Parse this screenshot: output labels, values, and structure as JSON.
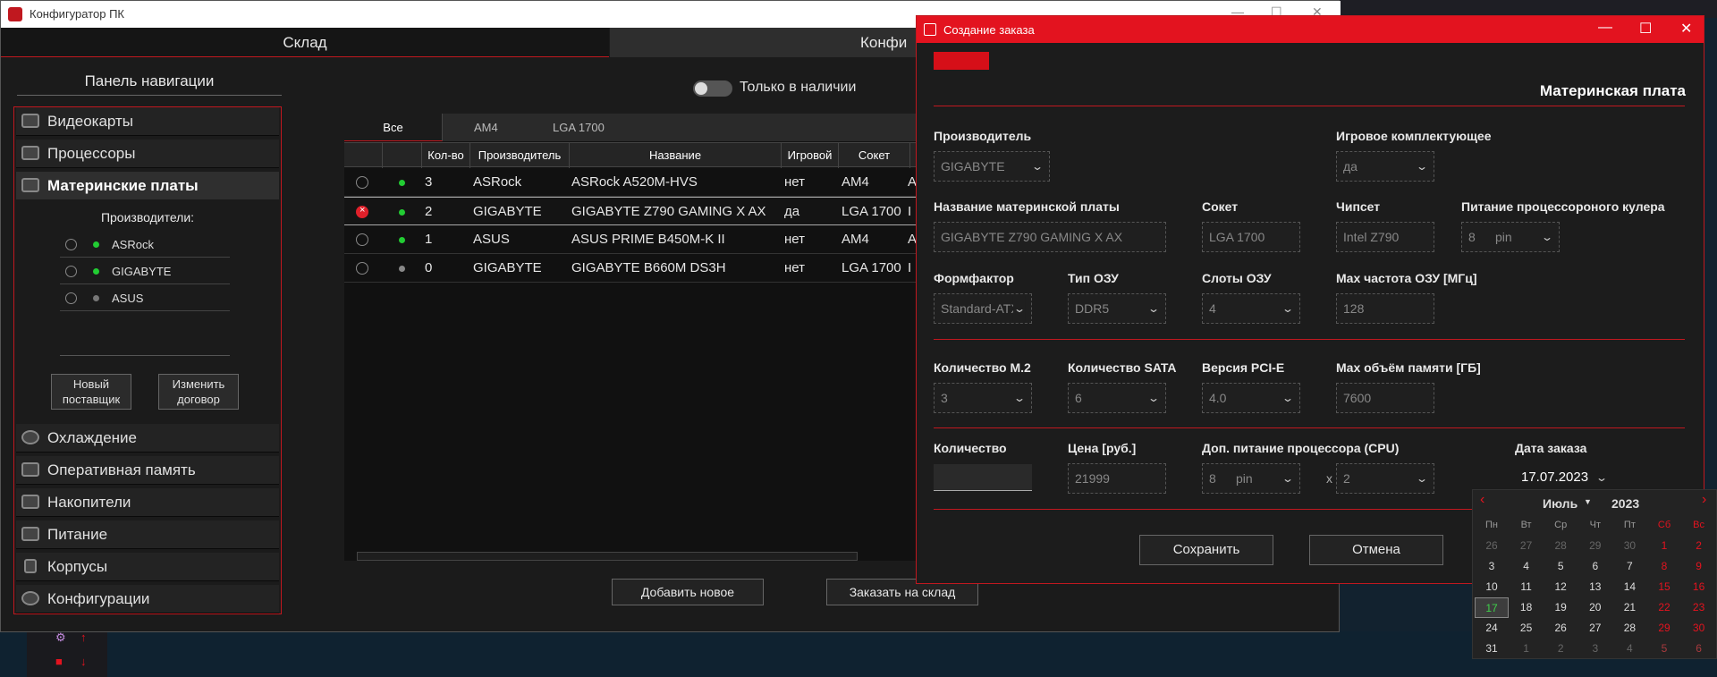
{
  "main_window": {
    "title": "Конфигуратор ПК",
    "tabs": [
      "Склад",
      "Конфи"
    ]
  },
  "nav": {
    "title": "Панель навигации",
    "items": [
      "Видеокарты",
      "Процессоры",
      "Материнские платы",
      "Охлаждение",
      "Оперативная память",
      "Накопители",
      "Питание",
      "Корпусы",
      "Конфигурации"
    ],
    "manufacturers_title": "Производители:",
    "manufacturers": [
      {
        "name": "ASRock",
        "status": "green"
      },
      {
        "name": "GIGABYTE",
        "status": "green"
      },
      {
        "name": "ASUS",
        "status": "grey"
      }
    ],
    "new_supplier": "Новый поставщик",
    "change_contract": "Изменить договор"
  },
  "filter": {
    "only_in_stock": "Только в наличии",
    "tabs": [
      "Все",
      "AM4",
      "LGA 1700"
    ]
  },
  "table": {
    "headers": [
      "Кол-во",
      "Производитель",
      "Название",
      "Игровой",
      "Сокет"
    ],
    "rows": [
      {
        "qty": "3",
        "maker": "ASRock",
        "name": "ASRock A520M-HVS",
        "gaming": "нет",
        "socket": "AM4",
        "extra": "A",
        "status": "green",
        "selected": false
      },
      {
        "qty": "2",
        "maker": "GIGABYTE",
        "name": "GIGABYTE Z790 GAMING X AX",
        "gaming": "да",
        "socket": "LGA 1700",
        "extra": "I",
        "status": "green",
        "selected": true
      },
      {
        "qty": "1",
        "maker": "ASUS",
        "name": "ASUS PRIME B450M-K II",
        "gaming": "нет",
        "socket": "AM4",
        "extra": "A",
        "status": "green",
        "selected": false
      },
      {
        "qty": "0",
        "maker": "GIGABYTE",
        "name": "GIGABYTE B660M DS3H",
        "gaming": "нет",
        "socket": "LGA 1700",
        "extra": "I",
        "status": "grey",
        "selected": false
      }
    ]
  },
  "buttons": {
    "add_new": "Добавить новое",
    "order_to_stock": "Заказать на склад"
  },
  "dialog": {
    "title": "Создание заказа",
    "heading": "Материнская плата",
    "labels": {
      "manufacturer": "Производитель",
      "gaming": "Игровое комплектующее",
      "board_name": "Название материнской платы",
      "socket": "Сокет",
      "chipset": "Чипсет",
      "cooler_power": "Питание процессороного кулера",
      "form_factor": "Формфактор",
      "ram_type": "Тип ОЗУ",
      "ram_slots": "Слоты ОЗУ",
      "max_ram_freq": "Max частота ОЗУ [МГц]",
      "m2_count": "Количество M.2",
      "sata_count": "Количество SATA",
      "pcie_version": "Версия PCI-E",
      "max_memory": "Max объём памяти [ГБ]",
      "quantity": "Количество",
      "price": "Цена [руб.]",
      "cpu_power": "Доп. питание процессора (CPU)",
      "order_date": "Дата заказа"
    },
    "values": {
      "manufacturer": "GIGABYTE",
      "gaming": "да",
      "board_name": "GIGABYTE Z790 GAMING X AX",
      "socket": "LGA 1700",
      "chipset": "Intel Z790",
      "cooler_power_num": "8",
      "cooler_power_unit": "pin",
      "form_factor": "Standard-ATX",
      "ram_type": "DDR5",
      "ram_slots": "4",
      "max_ram_freq": "128",
      "m2_count": "3",
      "sata_count": "6",
      "pcie_version": "4.0",
      "max_memory": "7600",
      "quantity": "",
      "price": "21999",
      "cpu_power_num": "8",
      "cpu_power_unit": "pin",
      "multiplier": "x",
      "cpu_power_count": "2",
      "order_date": "17.07.2023"
    },
    "save": "Сохранить",
    "cancel": "Отмена"
  },
  "calendar": {
    "month": "Июль",
    "year": "2023",
    "weekdays": [
      "Пн",
      "Вт",
      "Ср",
      "Чт",
      "Пт",
      "Сб",
      "Вс"
    ],
    "weeks": [
      [
        "26",
        "27",
        "28",
        "29",
        "30",
        "1",
        "2"
      ],
      [
        "3",
        "4",
        "5",
        "6",
        "7",
        "8",
        "9"
      ],
      [
        "10",
        "11",
        "12",
        "13",
        "14",
        "15",
        "16"
      ],
      [
        "17",
        "18",
        "19",
        "20",
        "21",
        "22",
        "23"
      ],
      [
        "24",
        "25",
        "26",
        "27",
        "28",
        "29",
        "30"
      ],
      [
        "31",
        "1",
        "2",
        "3",
        "4",
        "5",
        "6"
      ]
    ],
    "selected_day": "17"
  },
  "colors": {
    "accent": "#e3131f",
    "status_green": "#22cc33",
    "status_grey": "#888888"
  }
}
